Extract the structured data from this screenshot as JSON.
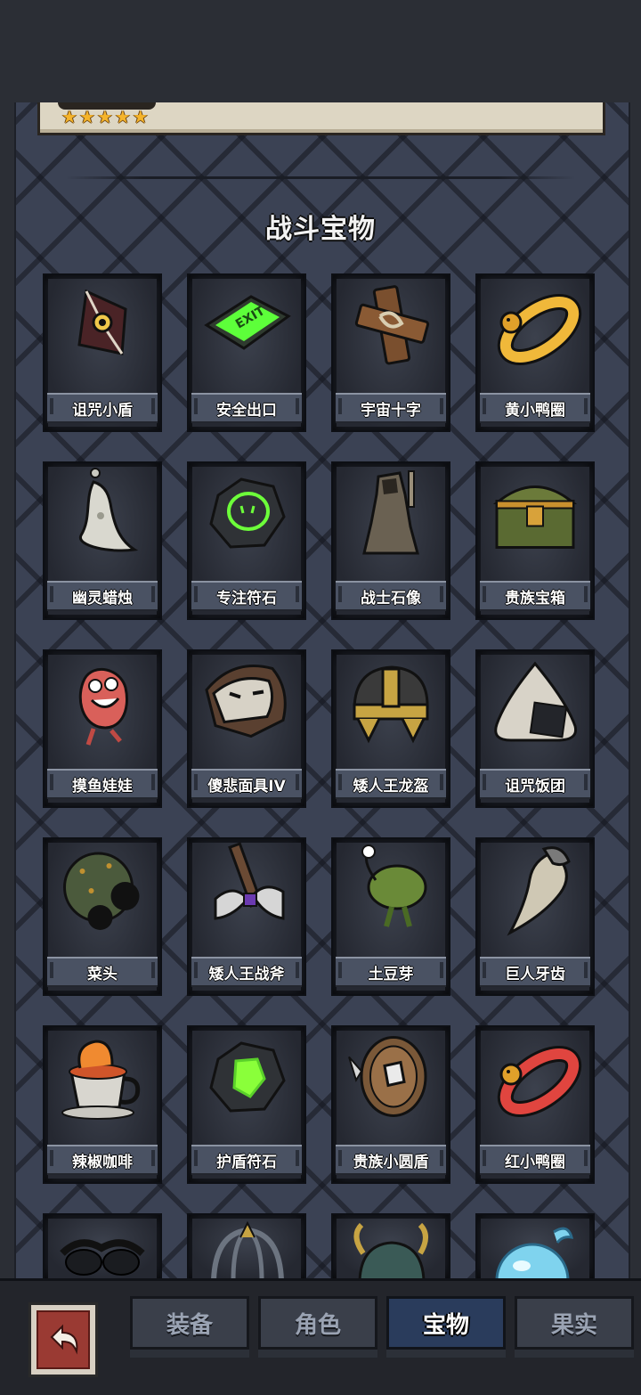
{
  "header": {
    "stars": 5
  },
  "section": {
    "title": "战斗宝物"
  },
  "items": [
    {
      "label": "诅咒小盾",
      "icon": "cursed-shield-icon"
    },
    {
      "label": "安全出口",
      "icon": "exit-sign-icon"
    },
    {
      "label": "宇宙十字",
      "icon": "wooden-cross-icon"
    },
    {
      "label": "黄小鸭圈",
      "icon": "yellow-duck-ring-icon"
    },
    {
      "label": "幽灵蜡烛",
      "icon": "ghost-candle-icon"
    },
    {
      "label": "专注符石",
      "icon": "focus-rune-icon"
    },
    {
      "label": "战士石像",
      "icon": "warrior-statue-icon"
    },
    {
      "label": "贵族宝箱",
      "icon": "noble-chest-icon"
    },
    {
      "label": "摸鱼娃娃",
      "icon": "fish-doll-icon"
    },
    {
      "label": "傻悲面具IV",
      "icon": "sad-mask-icon"
    },
    {
      "label": "矮人王龙盔",
      "icon": "dwarf-helmet-icon"
    },
    {
      "label": "诅咒饭团",
      "icon": "cursed-riceball-icon"
    },
    {
      "label": "菜头",
      "icon": "cabbage-head-icon"
    },
    {
      "label": "矮人王战斧",
      "icon": "dwarf-axe-icon"
    },
    {
      "label": "土豆芽",
      "icon": "potato-sprout-icon"
    },
    {
      "label": "巨人牙齿",
      "icon": "giant-tooth-icon"
    },
    {
      "label": "辣椒咖啡",
      "icon": "chili-coffee-icon"
    },
    {
      "label": "护盾符石",
      "icon": "shield-rune-icon"
    },
    {
      "label": "贵族小圆盾",
      "icon": "noble-buckler-icon"
    },
    {
      "label": "红小鸭圈",
      "icon": "red-duck-ring-icon"
    }
  ],
  "partial_items": [
    "sunglasses-icon",
    "cage-icon",
    "horned-helmet-icon",
    "water-orb-icon"
  ],
  "tabs": [
    {
      "label": "装备",
      "active": false
    },
    {
      "label": "角色",
      "active": false
    },
    {
      "label": "宝物",
      "active": true
    },
    {
      "label": "果实",
      "active": false
    }
  ],
  "colors": {
    "accent_tab": "#2a3c5c",
    "panel": "#3b4254",
    "star": "#f5b42b"
  }
}
